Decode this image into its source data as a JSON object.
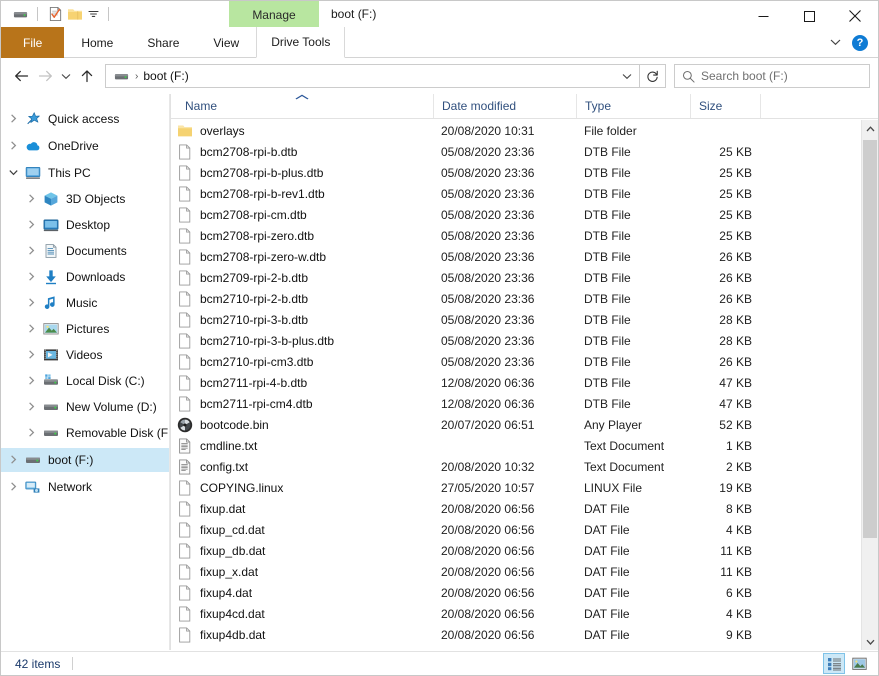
{
  "window": {
    "title": "boot (F:)",
    "contextual_group": "Manage",
    "minimize": "—",
    "maximize": "☐",
    "close": "✕",
    "collapse_ribbon": "⌄",
    "help": "?"
  },
  "quick_access_toolbar": {
    "drive_icon": "drive-icon",
    "properties_icon": "properties-icon",
    "new_folder_icon": "new-folder-icon",
    "customize_icon": "chevron-down-icon"
  },
  "ribbon": {
    "tabs": [
      {
        "label": "File",
        "kind": "file"
      },
      {
        "label": "Home",
        "kind": "normal"
      },
      {
        "label": "Share",
        "kind": "normal"
      },
      {
        "label": "View",
        "kind": "normal"
      },
      {
        "label": "Drive Tools",
        "kind": "contextual"
      }
    ]
  },
  "address_bar": {
    "back_icon": "back-arrow-icon",
    "forward_icon": "forward-arrow-icon",
    "recent_icon": "recent-locations-icon",
    "up_icon": "up-arrow-icon",
    "path_icon": "drive-icon",
    "path_separator": "›",
    "path_text": "boot (F:)",
    "dropdown_icon": "chevron-down-icon",
    "refresh_icon": "refresh-icon"
  },
  "search": {
    "icon": "search-icon",
    "placeholder": "Search boot (F:)"
  },
  "sidebar": {
    "items": [
      {
        "label": "Quick access",
        "indent": 0,
        "chevron": "closed",
        "icon": "star-icon",
        "selected": false,
        "spaced": true
      },
      {
        "label": "OneDrive",
        "indent": 0,
        "chevron": "closed",
        "icon": "cloud-icon",
        "selected": false,
        "spaced": true
      },
      {
        "label": "This PC",
        "indent": 0,
        "chevron": "open",
        "icon": "monitor-icon",
        "selected": false,
        "spaced": true
      },
      {
        "label": "3D Objects",
        "indent": 1,
        "chevron": "closed",
        "icon": "cube-icon",
        "selected": false,
        "spaced": false
      },
      {
        "label": "Desktop",
        "indent": 1,
        "chevron": "closed",
        "icon": "desktop-icon",
        "selected": false,
        "spaced": false
      },
      {
        "label": "Documents",
        "indent": 1,
        "chevron": "closed",
        "icon": "documents-icon",
        "selected": false,
        "spaced": false
      },
      {
        "label": "Downloads",
        "indent": 1,
        "chevron": "closed",
        "icon": "download-icon",
        "selected": false,
        "spaced": false
      },
      {
        "label": "Music",
        "indent": 1,
        "chevron": "closed",
        "icon": "music-note-icon",
        "selected": false,
        "spaced": false
      },
      {
        "label": "Pictures",
        "indent": 1,
        "chevron": "closed",
        "icon": "picture-icon",
        "selected": false,
        "spaced": false
      },
      {
        "label": "Videos",
        "indent": 1,
        "chevron": "closed",
        "icon": "video-icon",
        "selected": false,
        "spaced": false
      },
      {
        "label": "Local Disk (C:)",
        "indent": 1,
        "chevron": "closed",
        "icon": "local-disk-icon",
        "selected": false,
        "spaced": false
      },
      {
        "label": "New Volume (D:)",
        "indent": 1,
        "chevron": "closed",
        "icon": "drive-icon",
        "selected": false,
        "spaced": false
      },
      {
        "label": "Removable Disk (F:)",
        "indent": 1,
        "chevron": "closed",
        "icon": "drive-icon",
        "selected": false,
        "spaced": false
      },
      {
        "label": "boot (F:)",
        "indent": 0,
        "chevron": "closed",
        "icon": "drive-icon",
        "selected": true,
        "spaced": true
      },
      {
        "label": "Network",
        "indent": 0,
        "chevron": "closed",
        "icon": "network-icon",
        "selected": false,
        "spaced": true
      }
    ]
  },
  "filelist": {
    "columns": [
      {
        "label": "Name",
        "sorted": "asc"
      },
      {
        "label": "Date modified",
        "sorted": "none"
      },
      {
        "label": "Type",
        "sorted": "none"
      },
      {
        "label": "Size",
        "sorted": "none"
      }
    ],
    "rows": [
      {
        "name": "overlays",
        "date": "20/08/2020 10:31",
        "type": "File folder",
        "size": "",
        "icon": "folder-icon"
      },
      {
        "name": "bcm2708-rpi-b.dtb",
        "date": "05/08/2020 23:36",
        "type": "DTB File",
        "size": "25 KB",
        "icon": "file-icon"
      },
      {
        "name": "bcm2708-rpi-b-plus.dtb",
        "date": "05/08/2020 23:36",
        "type": "DTB File",
        "size": "25 KB",
        "icon": "file-icon"
      },
      {
        "name": "bcm2708-rpi-b-rev1.dtb",
        "date": "05/08/2020 23:36",
        "type": "DTB File",
        "size": "25 KB",
        "icon": "file-icon"
      },
      {
        "name": "bcm2708-rpi-cm.dtb",
        "date": "05/08/2020 23:36",
        "type": "DTB File",
        "size": "25 KB",
        "icon": "file-icon"
      },
      {
        "name": "bcm2708-rpi-zero.dtb",
        "date": "05/08/2020 23:36",
        "type": "DTB File",
        "size": "25 KB",
        "icon": "file-icon"
      },
      {
        "name": "bcm2708-rpi-zero-w.dtb",
        "date": "05/08/2020 23:36",
        "type": "DTB File",
        "size": "26 KB",
        "icon": "file-icon"
      },
      {
        "name": "bcm2709-rpi-2-b.dtb",
        "date": "05/08/2020 23:36",
        "type": "DTB File",
        "size": "26 KB",
        "icon": "file-icon"
      },
      {
        "name": "bcm2710-rpi-2-b.dtb",
        "date": "05/08/2020 23:36",
        "type": "DTB File",
        "size": "26 KB",
        "icon": "file-icon"
      },
      {
        "name": "bcm2710-rpi-3-b.dtb",
        "date": "05/08/2020 23:36",
        "type": "DTB File",
        "size": "28 KB",
        "icon": "file-icon"
      },
      {
        "name": "bcm2710-rpi-3-b-plus.dtb",
        "date": "05/08/2020 23:36",
        "type": "DTB File",
        "size": "28 KB",
        "icon": "file-icon"
      },
      {
        "name": "bcm2710-rpi-cm3.dtb",
        "date": "05/08/2020 23:36",
        "type": "DTB File",
        "size": "26 KB",
        "icon": "file-icon"
      },
      {
        "name": "bcm2711-rpi-4-b.dtb",
        "date": "12/08/2020 06:36",
        "type": "DTB File",
        "size": "47 KB",
        "icon": "file-icon"
      },
      {
        "name": "bcm2711-rpi-cm4.dtb",
        "date": "12/08/2020 06:36",
        "type": "DTB File",
        "size": "47 KB",
        "icon": "file-icon"
      },
      {
        "name": "bootcode.bin",
        "date": "20/07/2020 06:51",
        "type": "Any Player",
        "size": "52 KB",
        "icon": "media-player-icon"
      },
      {
        "name": "cmdline.txt",
        "date": "",
        "type": "Text Document",
        "size": "1 KB",
        "icon": "text-document-icon"
      },
      {
        "name": "config.txt",
        "date": "20/08/2020 10:32",
        "type": "Text Document",
        "size": "2 KB",
        "icon": "text-document-icon"
      },
      {
        "name": "COPYING.linux",
        "date": "27/05/2020 10:57",
        "type": "LINUX File",
        "size": "19 KB",
        "icon": "file-icon"
      },
      {
        "name": "fixup.dat",
        "date": "20/08/2020 06:56",
        "type": "DAT File",
        "size": "8 KB",
        "icon": "file-icon"
      },
      {
        "name": "fixup_cd.dat",
        "date": "20/08/2020 06:56",
        "type": "DAT File",
        "size": "4 KB",
        "icon": "file-icon"
      },
      {
        "name": "fixup_db.dat",
        "date": "20/08/2020 06:56",
        "type": "DAT File",
        "size": "11 KB",
        "icon": "file-icon"
      },
      {
        "name": "fixup_x.dat",
        "date": "20/08/2020 06:56",
        "type": "DAT File",
        "size": "11 KB",
        "icon": "file-icon"
      },
      {
        "name": "fixup4.dat",
        "date": "20/08/2020 06:56",
        "type": "DAT File",
        "size": "6 KB",
        "icon": "file-icon"
      },
      {
        "name": "fixup4cd.dat",
        "date": "20/08/2020 06:56",
        "type": "DAT File",
        "size": "4 KB",
        "icon": "file-icon"
      },
      {
        "name": "fixup4db.dat",
        "date": "20/08/2020 06:56",
        "type": "DAT File",
        "size": "9 KB",
        "icon": "file-icon"
      }
    ]
  },
  "statusbar": {
    "item_count": "42 items",
    "details_view_icon": "details-view-icon",
    "large_icons_view_icon": "large-icons-view-icon"
  },
  "colors": {
    "file_tab": "#b8741a",
    "contextual_header": "#b8e6a0",
    "selection": "#cce8f7",
    "column_header_text": "#31507e",
    "help_blue": "#0f7bd4"
  }
}
